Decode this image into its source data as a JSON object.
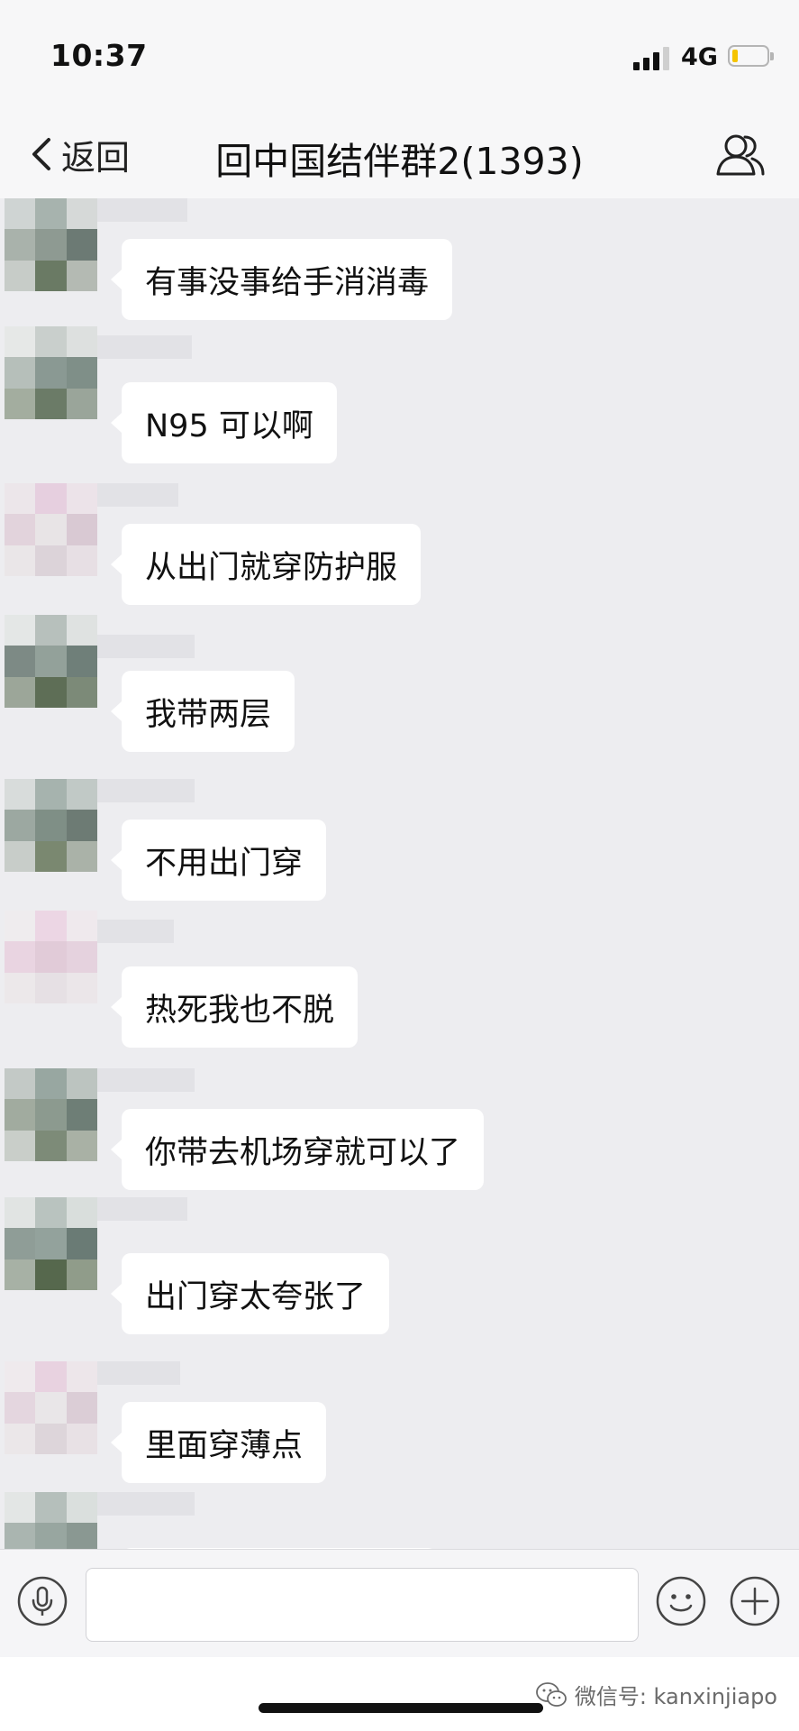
{
  "status_bar": {
    "time": "10:37",
    "network": "4G"
  },
  "nav": {
    "back_label": "返回",
    "title": "回中国结伴群2(1393)"
  },
  "messages": [
    {
      "text": "有事没事给手消消毒"
    },
    {
      "text": "N95 可以啊"
    },
    {
      "text": "从出门就穿防护服"
    },
    {
      "text": "我带两层"
    },
    {
      "text": "不用出门穿"
    },
    {
      "text": "热死我也不脱"
    },
    {
      "text": "你带去机场穿就可以了"
    },
    {
      "text": "出门穿太夸张了"
    },
    {
      "text": "里面穿薄点"
    },
    {
      "text": ""
    }
  ],
  "input_bar": {
    "placeholder": ""
  },
  "watermark": {
    "text": "微信号: kanxinjiapo"
  },
  "icons": {
    "back": "chevron-left-icon",
    "group": "group-members-icon",
    "voice": "microphone-icon",
    "emoji": "smiley-icon",
    "more": "plus-icon",
    "wechat": "wechat-logo-icon"
  },
  "colors": {
    "chat_background": "#ededf0",
    "bubble": "#ffffff",
    "battery_level": "#f5c400"
  }
}
